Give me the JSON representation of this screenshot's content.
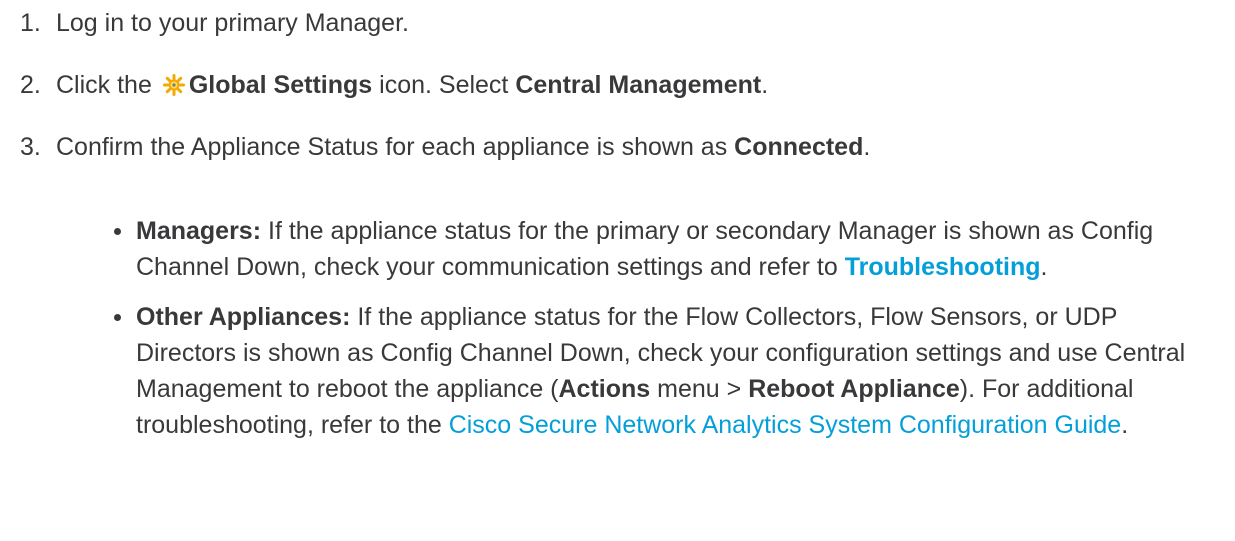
{
  "steps": [
    {
      "num": "1.",
      "text": "Log in to your primary Manager."
    },
    {
      "num": "2.",
      "pre": "Click the",
      "icon": "gear-icon",
      "b1": "Global Settings",
      "mid": "icon. Select",
      "b2": "Central Management",
      "end": "."
    },
    {
      "num": "3.",
      "pre": "Confirm the Appliance Status for each appliance is shown as",
      "b1": "Connected",
      "end": "."
    }
  ],
  "bullets": [
    {
      "label": "Managers:",
      "text": "If the appliance status for the primary or secondary Manager is shown as Config Channel Down, check your communication settings and refer to",
      "link": "Troubleshooting",
      "end": "."
    },
    {
      "label": "Other Appliances:",
      "text": "If the appliance status for the Flow Collectors, Flow Sensors, or UDP Directors is shown as Config Channel Down, check your configuration settings and use Central Management to reboot the appliance (",
      "b1": "Actions",
      "mid": "menu >",
      "b2": "Reboot Appliance",
      "text2": "). For additional troubleshooting, refer to the",
      "link": "Cisco Secure Network Analytics System Configuration Guide",
      "end": "."
    }
  ],
  "colors": {
    "text": "#39393b",
    "link": "#049fd9",
    "gear": "#f2a900"
  }
}
